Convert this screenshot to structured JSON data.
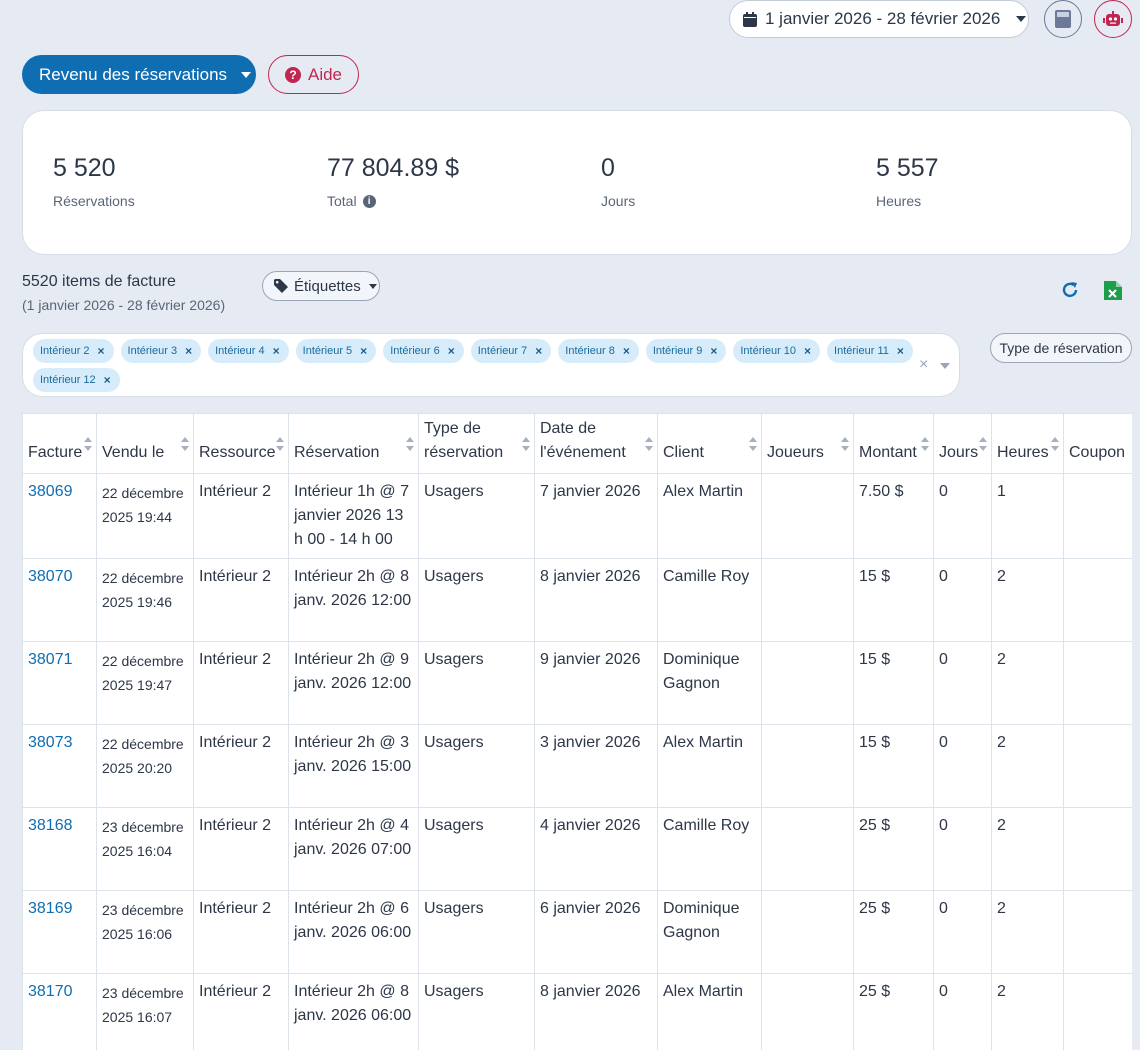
{
  "header": {
    "date_range": "1 janvier 2026 - 28 février 2026"
  },
  "toolbar": {
    "report_label": "Revenu des réservations",
    "help_label": "Aide"
  },
  "stats": [
    {
      "value": "5 520",
      "label": "Réservations"
    },
    {
      "value": "77 804.89 $",
      "label": "Total"
    },
    {
      "value": "0",
      "label": "Jours"
    },
    {
      "value": "5 557",
      "label": "Heures"
    }
  ],
  "items": {
    "title": "5520 items de facture",
    "subtitle": "(1 janvier 2026 - 28 février 2026)",
    "tags_label": "Étiquettes"
  },
  "filter": {
    "chips": [
      "Intérieur 2",
      "Intérieur 3",
      "Intérieur 4",
      "Intérieur 5",
      "Intérieur 6",
      "Intérieur 7",
      "Intérieur 8",
      "Intérieur 9",
      "Intérieur 10",
      "Intérieur 11",
      "Intérieur 12"
    ],
    "type_label": "Type de réservation"
  },
  "table": {
    "columns": [
      "Facture",
      "Vendu le",
      "Ressource",
      "Réservation",
      "Type de réservation",
      "Date de l'événement",
      "Client",
      "Joueurs",
      "Montant",
      "Jours",
      "Heures",
      "Coupon"
    ],
    "rows": [
      {
        "facture": "38069",
        "vendu": "22 décembre 2025 19:44",
        "ressource": "Intérieur 2",
        "reservation": "Intérieur 1h @ 7 janvier 2026 13 h 00 - 14 h 00",
        "type": "Usagers",
        "date": "7 janvier 2026",
        "client": "Alex Martin",
        "joueurs": "",
        "montant": "7.50 $",
        "jours": "0",
        "heures": "1",
        "coupon": ""
      },
      {
        "facture": "38070",
        "vendu": "22 décembre 2025 19:46",
        "ressource": "Intérieur 2",
        "reservation": "Intérieur 2h @ 8 janv. 2026 12:00",
        "type": "Usagers",
        "date": "8 janvier 2026",
        "client": "Camille Roy",
        "joueurs": "",
        "montant": "15 $",
        "jours": "0",
        "heures": "2",
        "coupon": ""
      },
      {
        "facture": "38071",
        "vendu": "22 décembre 2025 19:47",
        "ressource": "Intérieur 2",
        "reservation": "Intérieur 2h @ 9 janv. 2026 12:00",
        "type": "Usagers",
        "date": "9 janvier 2026",
        "client": "Dominique Gagnon",
        "joueurs": "",
        "montant": "15 $",
        "jours": "0",
        "heures": "2",
        "coupon": ""
      },
      {
        "facture": "38073",
        "vendu": "22 décembre 2025 20:20",
        "ressource": "Intérieur 2",
        "reservation": "Intérieur 2h @ 3 janv. 2026 15:00",
        "type": "Usagers",
        "date": "3 janvier 2026",
        "client": "Alex Martin",
        "joueurs": "",
        "montant": "15 $",
        "jours": "0",
        "heures": "2",
        "coupon": ""
      },
      {
        "facture": "38168",
        "vendu": "23 décembre 2025 16:04",
        "ressource": "Intérieur 2",
        "reservation": "Intérieur 2h @ 4 janv. 2026 07:00",
        "type": "Usagers",
        "date": "4 janvier 2026",
        "client": "Camille Roy",
        "joueurs": "",
        "montant": "25 $",
        "jours": "0",
        "heures": "2",
        "coupon": ""
      },
      {
        "facture": "38169",
        "vendu": "23 décembre 2025 16:06",
        "ressource": "Intérieur 2",
        "reservation": "Intérieur 2h @ 6 janv. 2026 06:00",
        "type": "Usagers",
        "date": "6 janvier 2026",
        "client": "Dominique Gagnon",
        "joueurs": "",
        "montant": "25 $",
        "jours": "0",
        "heures": "2",
        "coupon": ""
      },
      {
        "facture": "38170",
        "vendu": "23 décembre 2025 16:07",
        "ressource": "Intérieur 2",
        "reservation": "Intérieur 2h @ 8 janv. 2026 06:00",
        "type": "Usagers",
        "date": "8 janvier 2026",
        "client": "Alex Martin",
        "joueurs": "",
        "montant": "25 $",
        "jours": "0",
        "heures": "2",
        "coupon": ""
      }
    ]
  },
  "colors": {
    "primary": "#0f6eb1",
    "danger": "#c0264f",
    "background": "#e6ebf3",
    "chip_bg": "#d7ecfa",
    "excel_green": "#1e9e4a"
  },
  "icons": [
    "calendar-icon",
    "calculator-icon",
    "robot-icon",
    "question-icon",
    "info-icon",
    "tag-icon",
    "refresh-icon",
    "excel-icon",
    "sort-icon"
  ]
}
